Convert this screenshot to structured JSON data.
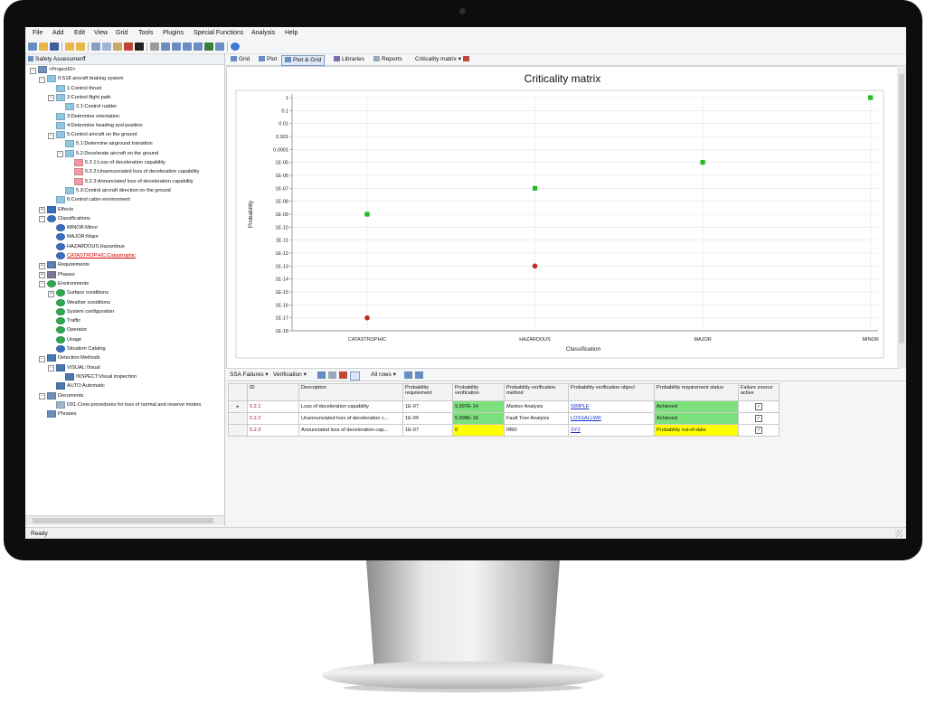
{
  "menu": [
    "File",
    "Add",
    "Edit",
    "View",
    "Grid",
    "Tools",
    "Plugins",
    "Special Functions",
    "Analysis",
    "Help"
  ],
  "left_panel": {
    "header": "Safety Assessment"
  },
  "tree": [
    {
      "label": "<ProjectID>",
      "icon": "project-icon",
      "color": "#6f8fb8"
    },
    {
      "label": "0:S18 aircraft braking system",
      "icon": "function-icon",
      "color": "#8fc6e0"
    },
    {
      "label": "1:Control thrust",
      "icon": "function-icon",
      "color": "#8fc6e0"
    },
    {
      "label": "2:Control flight path",
      "icon": "function-icon",
      "color": "#8fc6e0"
    },
    {
      "label": "2.1:Control rudder",
      "icon": "function-icon",
      "color": "#8fc6e0"
    },
    {
      "label": "3:Determine orientation",
      "icon": "function-icon",
      "color": "#8fc6e0"
    },
    {
      "label": "4:Determine heading and position",
      "icon": "function-icon",
      "color": "#8fc6e0"
    },
    {
      "label": "5:Control aircraft on the ground",
      "icon": "function-icon",
      "color": "#8fc6e0"
    },
    {
      "label": "5.1:Determine airground transition",
      "icon": "function-icon",
      "color": "#8fc6e0"
    },
    {
      "label": "5.2:Decelerate aircraft on the ground",
      "icon": "function-icon",
      "color": "#8fc6e0"
    },
    {
      "label": "5.2.1:Loss of deceleration capability",
      "icon": "failure-icon",
      "color": "#f29aa2"
    },
    {
      "label": "5.2.2:Unannunciated loss of deceleration capability",
      "icon": "failure-icon",
      "color": "#f29aa2"
    },
    {
      "label": "5.2.3:Annunciated loss of deceleration capability",
      "icon": "failure-icon",
      "color": "#f29aa2"
    },
    {
      "label": "5.3:Control aircraft direction on the ground",
      "icon": "function-icon",
      "color": "#8fc6e0"
    },
    {
      "label": "6:Control cabin environment",
      "icon": "function-icon",
      "color": "#8fc6e0"
    },
    {
      "label": "Effects",
      "icon": "effects-icon",
      "color": "#3a6fbf"
    },
    {
      "label": "Classifications",
      "icon": "classifications-icon",
      "color": "#3a6fbf"
    },
    {
      "label": "MINOR:Minor",
      "icon": "classification-icon",
      "color": "#3a6fbf"
    },
    {
      "label": "MAJOR:Major",
      "icon": "classification-icon",
      "color": "#3a6fbf"
    },
    {
      "label": "HAZARDOUS:Hazardous",
      "icon": "classification-icon",
      "color": "#3a6fbf"
    },
    {
      "label": "CATASTROPHIC:Catastrophic",
      "icon": "classification-icon",
      "color": "#3a6fbf",
      "text_color": "#d00000"
    },
    {
      "label": "Requirements",
      "icon": "requirements-icon",
      "color": "#5a7fb0"
    },
    {
      "label": "Phases",
      "icon": "phases-icon",
      "color": "#7a7a9a"
    },
    {
      "label": "Environments",
      "icon": "environments-icon",
      "color": "#2fa84f"
    },
    {
      "label": "Surface conditions",
      "icon": "environment-icon",
      "color": "#2fa84f"
    },
    {
      "label": "Weather conditions",
      "icon": "environment-icon",
      "color": "#2fa84f"
    },
    {
      "label": "System configuration",
      "icon": "environment-icon",
      "color": "#2fa84f"
    },
    {
      "label": "Traffic",
      "icon": "environment-icon",
      "color": "#2fa84f"
    },
    {
      "label": "Operator",
      "icon": "environment-icon",
      "color": "#2fa84f"
    },
    {
      "label": "Usage",
      "icon": "environment-icon",
      "color": "#2fa84f"
    },
    {
      "label": "Situation Catalog",
      "icon": "catalog-icon",
      "color": "#3a6fbf"
    },
    {
      "label": "Detection Methods",
      "icon": "detection-icon",
      "color": "#4a78b0"
    },
    {
      "label": "VISUAL:Visual",
      "icon": "magnifier-icon",
      "color": "#4a78b0"
    },
    {
      "label": "INSPECT:Visual inspection",
      "icon": "magnifier-icon",
      "color": "#4a78b0"
    },
    {
      "label": "AUTO:Automatic",
      "icon": "magnifier-icon",
      "color": "#4a78b0"
    },
    {
      "label": "Documents",
      "icon": "documents-icon",
      "color": "#6f8fb8"
    },
    {
      "label": "D01:Crew procedures for loss of normal and reserve modes",
      "icon": "document-icon",
      "color": "#a0b4cc"
    },
    {
      "label": "Phrases",
      "icon": "phrases-icon",
      "color": "#6f8fb8"
    }
  ],
  "right_tabs": [
    "Grid",
    "Plot",
    "Plot & Grid",
    "Libraries",
    "Reports",
    "Criticality matrix"
  ],
  "chart_data": {
    "type": "scatter",
    "title": "Criticality matrix",
    "xlabel": "Classification",
    "ylabel": "Probability",
    "categories": [
      "CATASTROPHIC",
      "HAZARDOUS",
      "MAJOR",
      "MINOR"
    ],
    "y_scale": "log",
    "y_ticks": [
      "1",
      "0.1",
      "0.01",
      "0.001",
      "0.0001",
      "1E-05",
      "1E-06",
      "1E-07",
      "1E-08",
      "1E-09",
      "1E-10",
      "1E-11",
      "1E-12",
      "1E-13",
      "1E-14",
      "1E-15",
      "1E-16",
      "1E-17",
      "1E-18"
    ],
    "ylim": [
      "1E-18",
      "1"
    ],
    "grid": true,
    "series": [
      {
        "color": "#22bb22",
        "points": [
          {
            "x": "CATASTROPHIC",
            "y": "1E-09"
          },
          {
            "x": "HAZARDOUS",
            "y": "1E-07"
          },
          {
            "x": "MAJOR",
            "y": "1E-05"
          },
          {
            "x": "MINOR",
            "y": "1"
          }
        ]
      },
      {
        "color": "#c62828",
        "points": [
          {
            "x": "CATASTROPHIC",
            "y": "1E-17"
          },
          {
            "x": "HAZARDOUS",
            "y": "1E-13"
          }
        ]
      }
    ]
  },
  "bottom_toolbar": {
    "ssa": "SSA Failures",
    "verification": "Verification",
    "rows": "All rows"
  },
  "grid": {
    "columns": [
      "ID",
      "Description",
      "Probability requirement",
      "Probability verification",
      "Probability verification method",
      "Probability verification object",
      "Probability requirement status",
      "Failure source active"
    ],
    "rows": [
      {
        "id": "5.2.1",
        "desc": "Loss of deceleration capability",
        "req": "1E-07",
        "ver": "9.997E-14",
        "method": "Markov Analysis",
        "object": "SIMPLE",
        "status": "Achieved",
        "ver_color": "green",
        "status_color": "green",
        "active": "✓"
      },
      {
        "id": "5.2.2",
        "desc": "Unannunciated loss of deceleration c...",
        "req": "1E-09",
        "ver": "5.998E-18",
        "method": "Fault Tree Analysis",
        "object": "LOSSALLWR",
        "status": "Achieved",
        "ver_color": "green",
        "status_color": "green",
        "active": "✓"
      },
      {
        "id": "5.2.3",
        "desc": "Annunciated loss of deceleration cap...",
        "req": "1E-07",
        "ver": "0",
        "method": "RBD",
        "object": "SYZ",
        "status": "Probability out-of-date",
        "ver_color": "yellow",
        "status_color": "yellow",
        "active": "✓"
      }
    ]
  },
  "status": "Ready"
}
